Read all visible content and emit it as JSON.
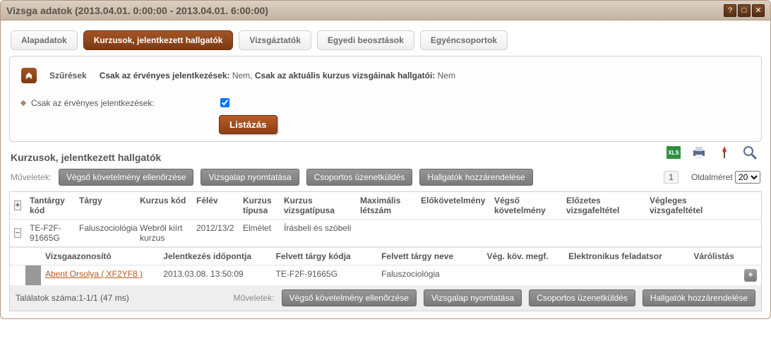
{
  "window": {
    "title": "Vizsga adatok (2013.04.01. 0:00:00 - 2013.04.01. 6:00:00)"
  },
  "tabs": [
    {
      "label": "Alapadatok"
    },
    {
      "label": "Kurzusok, jelentkezett hallgatók"
    },
    {
      "label": "Vizsgáztatók"
    },
    {
      "label": "Egyedi beosztások"
    },
    {
      "label": "Egyéncsoportok"
    }
  ],
  "filters": {
    "title": "Szűrések",
    "summary_label1": "Csak az érvényes jelentkezések:",
    "summary_val1": "Nem,",
    "summary_label2": "Csak az aktuális kurzus vizsgáinak hallgatói:",
    "summary_val2": "Nem",
    "checkbox_label": "Csak az érvényes jelentkezések:",
    "list_button": "Listázás"
  },
  "section_title": "Kurzusok, jelentkezett hallgatók",
  "ops": {
    "label": "Műveletek:",
    "b1": "Végső követelmény ellenőrzése",
    "b2": "Vizsgalap nyomtatása",
    "b3": "Csoportos üzenetküldés",
    "b4": "Hallgatók hozzárendelése",
    "pager_page": "1",
    "pagesize_label": "Oldalméret",
    "pagesize_value": "20"
  },
  "columns": {
    "tantargy": "Tantárgy kód",
    "targy": "Tárgy",
    "kurzuskod": "Kurzus kód",
    "felev": "Félév",
    "ktip": "Kurzus típusa",
    "kviz": "Kurzus vizsgatípusa",
    "max": "Maximális létszám",
    "elok": "Előkövetelmény",
    "vegso": "Végső követelmény",
    "elozetes": "Előzetes vizsgafeltétel",
    "vegleges": "Végleges vizsgafeltétel"
  },
  "row": {
    "tantargy": "TE-F2F-91665G",
    "targy": "Faluszociológia",
    "kurzuskod": "Webről kiírt kurzus",
    "felev": "2012/13/2",
    "ktip": "Elmélet",
    "kviz": "Írásbeli és szóbeli",
    "max": "",
    "elok": "",
    "vegso": "",
    "elozetes": "",
    "vegleges": ""
  },
  "subcolumns": {
    "id": "Vizsgaazonosító",
    "jel": "Jelentkezés időpontja",
    "ftk": "Felvett tárgy kódja",
    "ftn": "Felvett tárgy neve",
    "vkm": "Vég. köv. megf.",
    "ef": "Elektronikus feladatsor",
    "var": "Várólistás"
  },
  "subrow": {
    "id": "Abent Orsolya ( XF2YF8 )",
    "jel": "2013.03.08. 13:50:09",
    "ftk": "TE-F2F-91665G",
    "ftn": "Faluszociológia",
    "vkm": "",
    "ef": "",
    "var": ""
  },
  "footer": {
    "results": "Találatok száma:1-1/1 (47 ms)"
  }
}
